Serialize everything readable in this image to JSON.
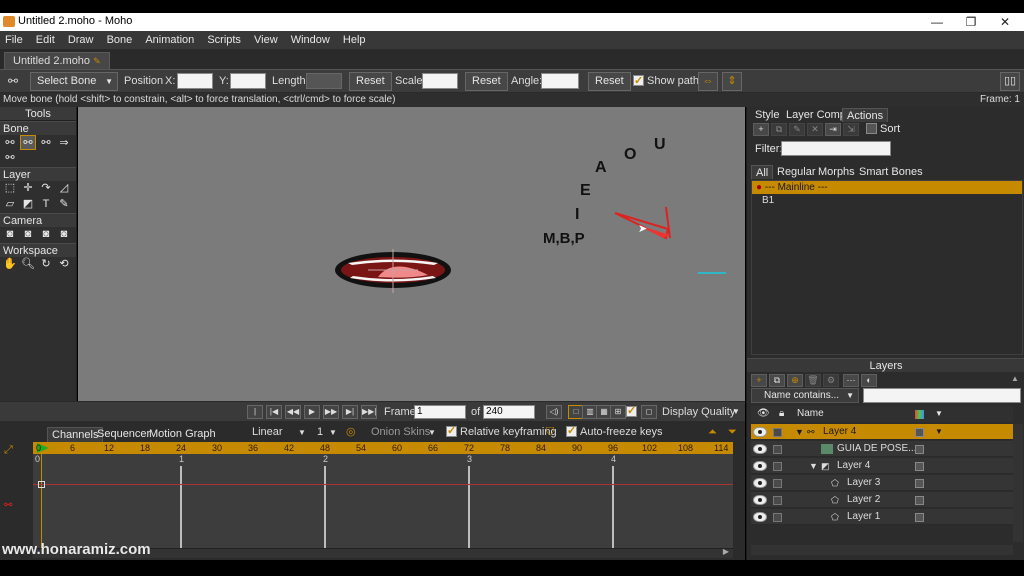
{
  "window": {
    "title": "Untitled 2.moho - Moho",
    "controls": [
      "minimize-icon",
      "restore-icon",
      "close-icon"
    ]
  },
  "menu": [
    "File",
    "Edit",
    "Draw",
    "Bone",
    "Animation",
    "Scripts",
    "View",
    "Window",
    "Help"
  ],
  "doc_tab": "Untitled 2.moho",
  "options": {
    "tool_select": "Select Bone",
    "position_label": "Position",
    "x_label": "X:",
    "y_label": "Y:",
    "length_label": "Length:",
    "reset1": "Reset",
    "scale_label": "Scale:",
    "reset2": "Reset",
    "angle_label": "Angle:",
    "reset3": "Reset",
    "show_path": "Show path"
  },
  "status": {
    "hint": "Move bone (hold <shift> to constrain, <alt> to force translation, <ctrl/cmd> to force scale)",
    "frame": "Frame: 1"
  },
  "tools": {
    "title": "Tools",
    "sections": [
      "Bone",
      "Layer",
      "Camera",
      "Workspace"
    ]
  },
  "canvas": {
    "labels": {
      "a": "A",
      "o": "O",
      "u": "U",
      "e": "E",
      "i": "I",
      "mbp": "M,B,P"
    }
  },
  "playback": {
    "frame_label": "Frame",
    "frame_value": "1",
    "of_label": "of",
    "total_frames": "240",
    "display_quality": "Display Quality"
  },
  "timeline": {
    "tabs": [
      "Channels",
      "Sequencer",
      "Motion Graph"
    ],
    "interpolation": "Linear",
    "step": "1",
    "onion_skins": "Onion Skins",
    "relative_keyframing": "Relative keyframing",
    "auto_freeze": "Auto-freeze keys",
    "ruler": [
      "0",
      "6",
      "12",
      "18",
      "24",
      "30",
      "36",
      "42",
      "48",
      "54",
      "60",
      "66",
      "72",
      "78",
      "84",
      "90",
      "96",
      "102",
      "108",
      "114"
    ],
    "seconds": [
      "0",
      "1",
      "2",
      "3",
      "4"
    ]
  },
  "right_panel": {
    "tabs": [
      "Style",
      "Layer Comps",
      "Actions"
    ],
    "sort_label": "Sort",
    "filter_label": "Filter:",
    "filter_tabs": [
      "All",
      "Regular",
      "Morphs",
      "Smart Bones"
    ],
    "actions": [
      "--- Mainline ---",
      "B1"
    ],
    "layers_title": "Layers",
    "name_contains": "Name contains...",
    "name_header": "Name",
    "layers": [
      {
        "name": "Layer 4",
        "indent": 1
      },
      {
        "name": "GUIA DE POSE...",
        "indent": 2
      },
      {
        "name": "Layer 4",
        "indent": 2
      },
      {
        "name": "Layer 3",
        "indent": 3
      },
      {
        "name": "Layer 2",
        "indent": 3
      },
      {
        "name": "Layer 1",
        "indent": 3
      }
    ]
  },
  "watermark": "www.honaramiz.com",
  "colors": {
    "accent": "#c68a00",
    "canvas": "#7b7b7b",
    "panel": "#2c2c2c"
  }
}
